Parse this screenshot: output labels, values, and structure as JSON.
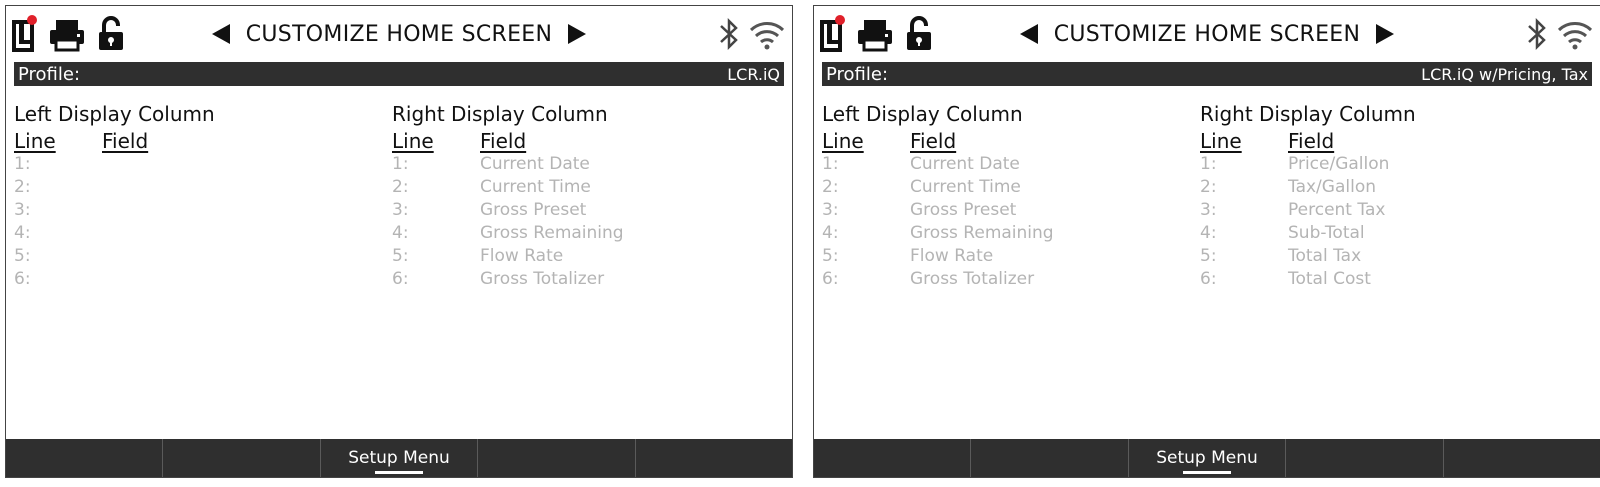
{
  "screens": [
    {
      "title": "CUSTOMIZE HOME SCREEN",
      "profile_label": "Profile:",
      "profile_value": "LCR.iQ",
      "left_column": {
        "title": "Left Display Column",
        "line_header": "Line",
        "field_header": "Field",
        "rows": [
          {
            "line": "1:",
            "field": ""
          },
          {
            "line": "2:",
            "field": ""
          },
          {
            "line": "3:",
            "field": ""
          },
          {
            "line": "4:",
            "field": ""
          },
          {
            "line": "5:",
            "field": ""
          },
          {
            "line": "6:",
            "field": ""
          }
        ]
      },
      "right_column": {
        "title": "Right Display Column",
        "line_header": "Line",
        "field_header": "Field",
        "rows": [
          {
            "line": "1:",
            "field": "Current Date"
          },
          {
            "line": "2:",
            "field": "Current Time"
          },
          {
            "line": "3:",
            "field": "Gross Preset"
          },
          {
            "line": "4:",
            "field": "Gross Remaining"
          },
          {
            "line": "5:",
            "field": "Flow Rate"
          },
          {
            "line": "6:",
            "field": "Gross Totalizer"
          }
        ]
      },
      "softkeys": [
        "",
        "",
        "Setup Menu",
        "",
        ""
      ]
    },
    {
      "title": "CUSTOMIZE HOME SCREEN",
      "profile_label": "Profile:",
      "profile_value": "LCR.iQ w/Pricing, Tax",
      "left_column": {
        "title": "Left Display Column",
        "line_header": "Line",
        "field_header": "Field",
        "rows": [
          {
            "line": "1:",
            "field": "Current Date"
          },
          {
            "line": "2:",
            "field": "Current Time"
          },
          {
            "line": "3:",
            "field": "Gross Preset"
          },
          {
            "line": "4:",
            "field": "Gross Remaining"
          },
          {
            "line": "5:",
            "field": "Flow Rate"
          },
          {
            "line": "6:",
            "field": "Gross Totalizer"
          }
        ]
      },
      "right_column": {
        "title": "Right Display Column",
        "line_header": "Line",
        "field_header": "Field",
        "rows": [
          {
            "line": "1:",
            "field": "Price/Gallon"
          },
          {
            "line": "2:",
            "field": "Tax/Gallon"
          },
          {
            "line": "3:",
            "field": "Percent Tax"
          },
          {
            "line": "4:",
            "field": "Sub-Total"
          },
          {
            "line": "5:",
            "field": "Total Tax"
          },
          {
            "line": "6:",
            "field": "Total Cost"
          }
        ]
      },
      "softkeys": [
        "",
        "",
        "Setup Menu",
        "",
        ""
      ]
    }
  ],
  "icons": [
    "lc-logo-icon",
    "printer-icon",
    "unlock-icon",
    "bluetooth-icon",
    "wifi-icon"
  ],
  "colors": {
    "bar": "#2f2f2f",
    "muted_text": "#b4b4b4",
    "logo_dot": "#e0202a"
  }
}
